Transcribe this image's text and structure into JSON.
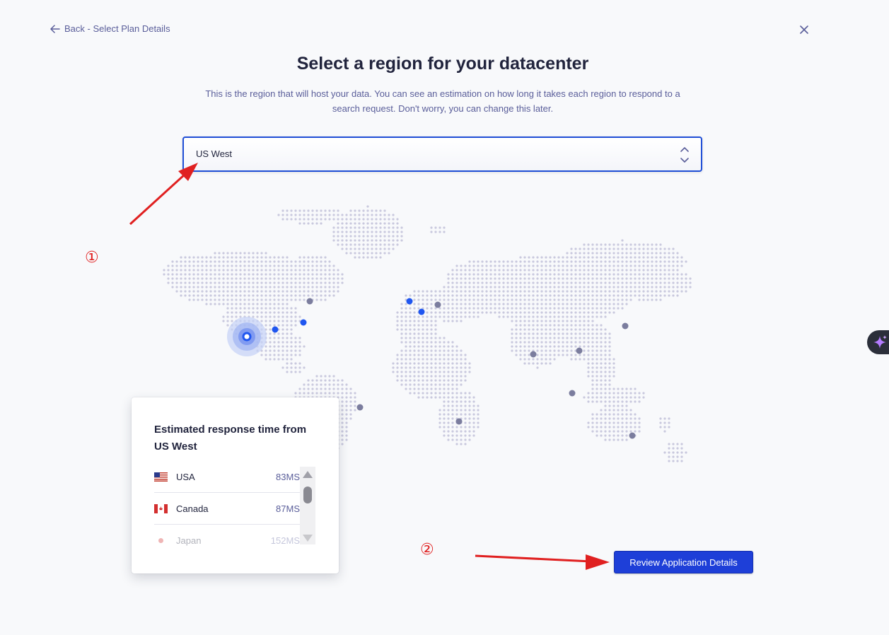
{
  "header": {
    "back_label": "Back - Select Plan Details",
    "title": "Select a region for your datacenter",
    "subtitle": "This is the region that will host your data. You can see an estimation on how long it takes each region to respond to a search request. Don't worry, you can change this later."
  },
  "region_select": {
    "selected": "US West"
  },
  "response_panel": {
    "title": "Estimated response time from US West",
    "rows": [
      {
        "country": "USA",
        "time": "83MS",
        "flag": "us-flag"
      },
      {
        "country": "Canada",
        "time": "87MS",
        "flag": "canada-flag"
      },
      {
        "country": "Japan",
        "time": "152MS",
        "flag": "japan-flag"
      }
    ]
  },
  "actions": {
    "review_label": "Review Application Details"
  },
  "annotations": {
    "marker_1": "①",
    "marker_2": "②"
  },
  "colors": {
    "accent": "#1e3fd8",
    "selected_region": "#1f4ed6",
    "active_dot": "#1f56f0",
    "inactive_dot": "#7b7d9e",
    "map_dot": "#c9c9de",
    "annotation": "#e02020"
  },
  "icons": {
    "back": "arrow-left-icon",
    "close": "close-icon",
    "select": "chevron-up-down-icon",
    "assist": "sparkle-icon"
  }
}
